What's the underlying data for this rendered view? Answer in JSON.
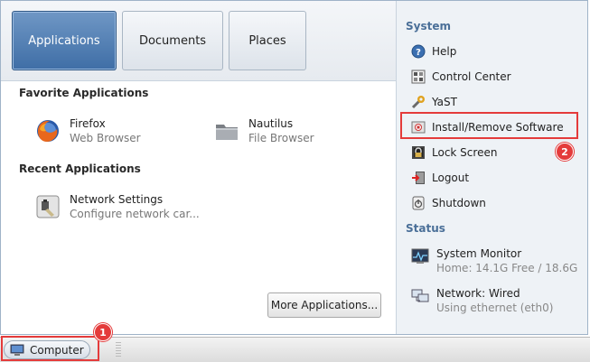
{
  "tabs": [
    {
      "label": "Applications",
      "active": true
    },
    {
      "label": "Documents",
      "active": false
    },
    {
      "label": "Places",
      "active": false
    }
  ],
  "favorites": {
    "title": "Favorite Applications",
    "items": [
      {
        "name": "Firefox",
        "desc": "Web Browser",
        "icon": "firefox-icon"
      },
      {
        "name": "Nautilus",
        "desc": "File Browser",
        "icon": "folder-icon"
      }
    ]
  },
  "recent": {
    "title": "Recent Applications",
    "items": [
      {
        "name": "Network Settings",
        "desc": "Configure network car...",
        "icon": "network-settings-icon"
      }
    ]
  },
  "more_button": "More Applications...",
  "system": {
    "title": "System",
    "items": [
      {
        "label": "Help",
        "icon": "help-icon"
      },
      {
        "label": "Control Center",
        "icon": "control-center-icon"
      },
      {
        "label": "YaST",
        "icon": "yast-icon"
      },
      {
        "label": "Install/Remove Software",
        "icon": "package-icon"
      },
      {
        "label": "Lock Screen",
        "icon": "lock-icon"
      },
      {
        "label": "Logout",
        "icon": "logout-icon"
      },
      {
        "label": "Shutdown",
        "icon": "shutdown-icon"
      }
    ]
  },
  "status": {
    "title": "Status",
    "items": [
      {
        "name": "System Monitor",
        "desc": "Home: 14.1G Free / 18.6G",
        "icon": "system-monitor-icon"
      },
      {
        "name": "Network: Wired",
        "desc": "Using ethernet (eth0)",
        "icon": "network-wired-icon"
      }
    ]
  },
  "callouts": [
    "1",
    "2"
  ],
  "taskbar": {
    "computer_label": "Computer",
    "icon": "computer-icon"
  },
  "colors": {
    "highlight": "#e43b3b",
    "active_tab": "#4f7db3",
    "section_title": "#4a6f98"
  }
}
